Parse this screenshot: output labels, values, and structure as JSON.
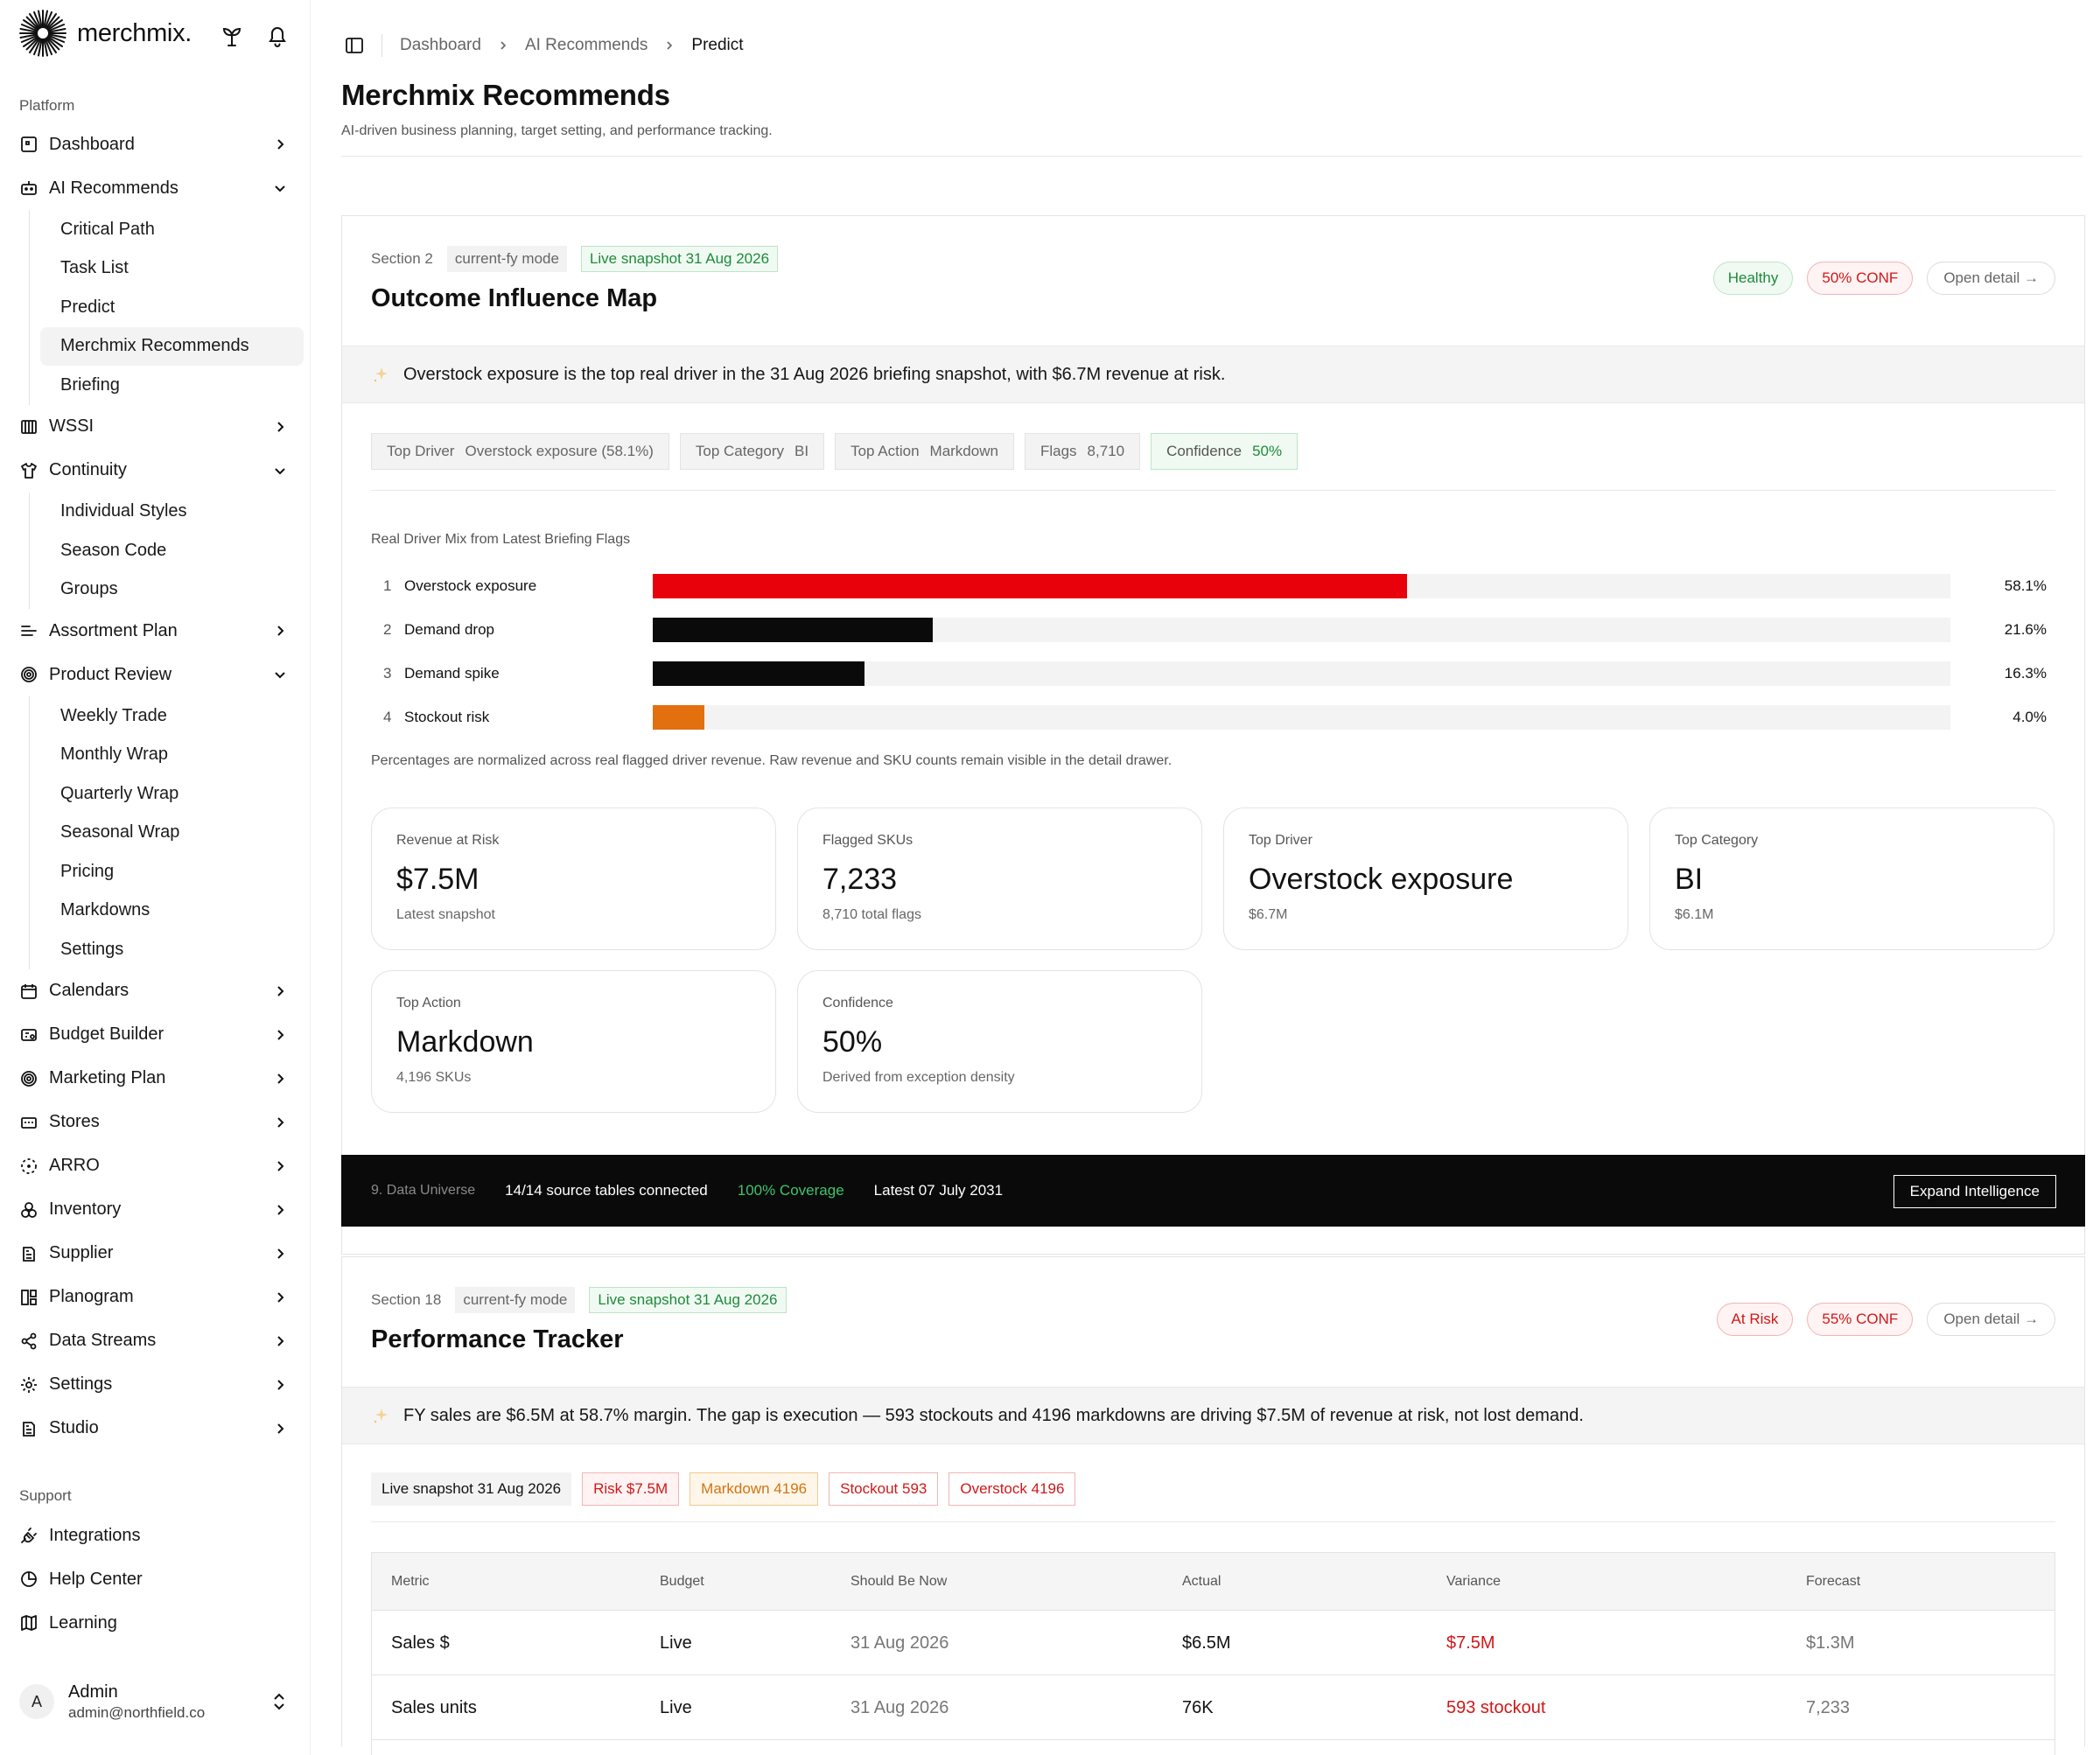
{
  "brand": {
    "name": "merchmix."
  },
  "sidebar": {
    "platform_label": "Platform",
    "support_label": "Support",
    "items": [
      {
        "label": "Dashboard",
        "icon": "dashboard-icon",
        "expanded": false
      },
      {
        "label": "AI Recommends",
        "icon": "bot-icon",
        "expanded": true,
        "children": [
          "Critical Path",
          "Task List",
          "Predict",
          "Merchmix Recommends",
          "Briefing"
        ],
        "active_child": 3
      },
      {
        "label": "WSSI",
        "icon": "columns-icon",
        "expanded": false
      },
      {
        "label": "Continuity",
        "icon": "shirt-icon",
        "expanded": true,
        "children": [
          "Individual Styles",
          "Season Code",
          "Groups"
        ]
      },
      {
        "label": "Assortment Plan",
        "icon": "list-icon",
        "expanded": false
      },
      {
        "label": "Product Review",
        "icon": "target-icon",
        "expanded": true,
        "children": [
          "Weekly Trade",
          "Monthly Wrap",
          "Quarterly Wrap",
          "Seasonal Wrap",
          "Pricing",
          "Markdowns",
          "Settings"
        ]
      },
      {
        "label": "Calendars",
        "icon": "calendar-icon",
        "expanded": false
      },
      {
        "label": "Budget Builder",
        "icon": "budget-icon",
        "expanded": false
      },
      {
        "label": "Marketing Plan",
        "icon": "target-icon",
        "expanded": false
      },
      {
        "label": "Stores",
        "icon": "store-icon",
        "expanded": false
      },
      {
        "label": "ARRO",
        "icon": "dashed-circle-icon",
        "expanded": false
      },
      {
        "label": "Inventory",
        "icon": "boxes-icon",
        "expanded": false
      },
      {
        "label": "Supplier",
        "icon": "building-icon",
        "expanded": false
      },
      {
        "label": "Planogram",
        "icon": "layout-icon",
        "expanded": false
      },
      {
        "label": "Data Streams",
        "icon": "share-icon",
        "expanded": false
      },
      {
        "label": "Settings",
        "icon": "gear-icon",
        "expanded": false
      },
      {
        "label": "Studio",
        "icon": "building-icon",
        "expanded": false
      }
    ],
    "support_items": [
      {
        "label": "Integrations",
        "icon": "plug-icon"
      },
      {
        "label": "Help Center",
        "icon": "help-icon"
      },
      {
        "label": "Learning",
        "icon": "map-icon"
      }
    ],
    "user": {
      "initial": "A",
      "name": "Admin",
      "email": "admin@northfield.co"
    }
  },
  "breadcrumb": [
    "Dashboard",
    "AI Recommends",
    "Predict"
  ],
  "page": {
    "title": "Merchmix Recommends",
    "subtitle": "AI-driven business planning, target setting, and performance tracking."
  },
  "section1": {
    "label": "Section 2",
    "mode": "current-fy mode",
    "snapshot": "Live snapshot 31 Aug 2026",
    "title": "Outcome Influence Map",
    "status": "Healthy",
    "conf": "50% CONF",
    "open": "Open detail →",
    "insight": "Overstock exposure is the top real driver in the 31 Aug 2026 briefing snapshot, with $6.7M revenue at risk.",
    "chips": [
      {
        "k": "Top Driver",
        "v": "Overstock exposure (58.1%)"
      },
      {
        "k": "Top Category",
        "v": "BI"
      },
      {
        "k": "Top Action",
        "v": "Markdown"
      },
      {
        "k": "Flags",
        "v": "8,710"
      },
      {
        "k": "Confidence",
        "v": "50%"
      }
    ],
    "mix_title": "Real Driver Mix from Latest Briefing Flags",
    "mix": [
      {
        "rank": "1",
        "name": "Overstock exposure",
        "pct_label": "58.1%",
        "fraction": 0.581,
        "color": "#e8000b"
      },
      {
        "rank": "2",
        "name": "Demand drop",
        "pct_label": "21.6%",
        "fraction": 0.216,
        "color": "#0a0a0a"
      },
      {
        "rank": "3",
        "name": "Demand spike",
        "pct_label": "16.3%",
        "fraction": 0.163,
        "color": "#0a0a0a"
      },
      {
        "rank": "4",
        "name": "Stockout risk",
        "pct_label": "4.0%",
        "fraction": 0.04,
        "color": "#e2700f"
      }
    ],
    "mix_note": "Percentages are normalized across real flagged driver revenue. Raw revenue and SKU counts remain visible in the detail drawer.",
    "kpis": [
      {
        "label": "Revenue at Risk",
        "value": "$7.5M",
        "sub": "Latest snapshot"
      },
      {
        "label": "Flagged SKUs",
        "value": "7,233",
        "sub": "8,710 total flags"
      },
      {
        "label": "Top Driver",
        "value": "Overstock exposure",
        "sub": "$6.7M"
      },
      {
        "label": "Top Category",
        "value": "BI",
        "sub": "$6.1M"
      },
      {
        "label": "Top Action",
        "value": "Markdown",
        "sub": "4,196 SKUs"
      },
      {
        "label": "Confidence",
        "value": "50%",
        "sub": "Derived from exception density"
      }
    ],
    "universe": {
      "label": "9. Data Universe",
      "tables": "14/14 source tables connected",
      "coverage": "100% Coverage",
      "latest": "Latest 07 July 2031",
      "button": "Expand Intelligence"
    }
  },
  "section2": {
    "label": "Section 18",
    "mode": "current-fy mode",
    "snapshot": "Live snapshot 31 Aug 2026",
    "title": "Performance Tracker",
    "status": "At Risk",
    "conf": "55% CONF",
    "open": "Open detail →",
    "insight": "FY sales are $6.5M at 58.7% margin. The gap is execution — 593 stockouts and 4196 markdowns are driving $7.5M of revenue at risk, not lost demand.",
    "chips": [
      "Live snapshot 31 Aug 2026",
      "Risk $7.5M",
      "Markdown 4196",
      "Stockout 593",
      "Overstock 4196"
    ],
    "table": {
      "headers": [
        "Metric",
        "Budget",
        "Should Be Now",
        "Actual",
        "Variance",
        "Forecast"
      ],
      "rows": [
        [
          "Sales $",
          "Live",
          "31 Aug 2026",
          "$6.5M",
          "$7.5M",
          "$1.3M"
        ],
        [
          "Sales units",
          "Live",
          "31 Aug 2026",
          "76K",
          "593 stockout",
          "7,233"
        ]
      ]
    }
  }
}
